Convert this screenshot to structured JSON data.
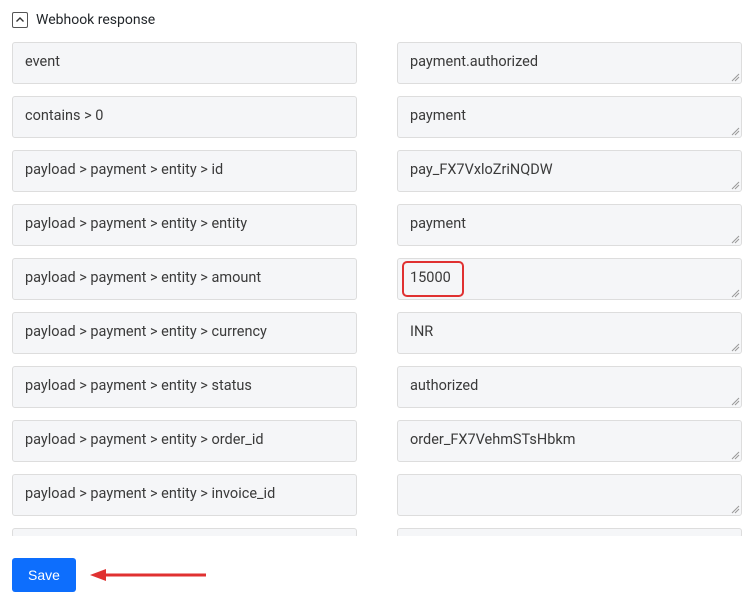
{
  "sectionTitle": "Webhook response",
  "rows": [
    {
      "key": "event",
      "value": "payment.authorized"
    },
    {
      "key": "contains > 0",
      "value": "payment"
    },
    {
      "key": "payload > payment > entity > id",
      "value": "pay_FX7VxloZriNQDW"
    },
    {
      "key": "payload > payment > entity > entity",
      "value": "payment"
    },
    {
      "key": "payload > payment > entity > amount",
      "value": "15000",
      "highlight": true
    },
    {
      "key": "payload > payment > entity > currency",
      "value": "INR"
    },
    {
      "key": "payload > payment > entity > status",
      "value": "authorized"
    },
    {
      "key": "payload > payment > entity > order_id",
      "value": "order_FX7VehmSTsHbkm"
    },
    {
      "key": "payload > payment > entity > invoice_id",
      "value": ""
    }
  ],
  "saveLabel": "Save",
  "colors": {
    "primary": "#0d6efd",
    "annotation": "#e03131",
    "fieldBg": "#f5f6f8",
    "fieldBorder": "#ddd"
  },
  "icons": {
    "collapse": "chevron-up-icon",
    "resize": "resize-handle-icon",
    "arrow": "left-arrow-annotation"
  }
}
